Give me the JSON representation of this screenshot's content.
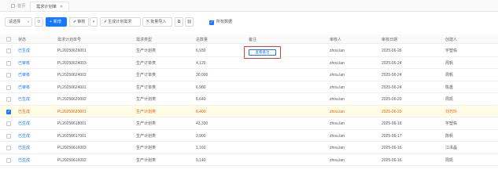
{
  "tabs": {
    "home": "首页",
    "current": "需求计划单"
  },
  "toolbar": {
    "select_value": "请选择",
    "new_label": "新增",
    "audit_label": "审核",
    "generate_label": "生成计划需求",
    "import_label": "批量导入",
    "show_all_label": "所有数据"
  },
  "table": {
    "headers": {
      "status": "状态",
      "no": "需求计划单号",
      "type": "需求类型",
      "qty": "总数量",
      "memo": "备注",
      "auditor": "审核人",
      "audit_date": "审核日期",
      "creator": "创建人"
    },
    "rows": [
      {
        "status": "已生成",
        "no": "PL20250626001",
        "type": "生产计划类",
        "qty": "6,930",
        "memo": "",
        "auditor": "zhou.lan",
        "date": "2025-06-26",
        "creator": "宇塑佑"
      },
      {
        "status": "已审核",
        "no": "PL20250624003",
        "type": "生产订单类",
        "qty": "4,120",
        "memo": "",
        "auditor": "zhou.lan",
        "date": "2025-06-24",
        "creator": "周帆"
      },
      {
        "status": "已审核",
        "no": "PL20250624002",
        "type": "生产订单类",
        "qty": "30,000",
        "memo": "",
        "auditor": "zhou.lan",
        "date": "2025-06-24",
        "creator": "周帆"
      },
      {
        "status": "已审核",
        "no": "PL20250624001",
        "type": "生产订单类",
        "qty": "6,980",
        "memo": "",
        "auditor": "zhou.lan",
        "date": "2025-06-24",
        "creator": "陈勇"
      },
      {
        "status": "已生成",
        "no": "PL20250620002",
        "type": "生产计划类",
        "qty": "5,640",
        "memo": "",
        "auditor": "zhou.lan",
        "date": "2025-06-20",
        "creator": "周凯"
      },
      {
        "status": "已生成",
        "no": "PL20250620001",
        "type": "生产计划类",
        "qty": "6,400",
        "memo": "",
        "auditor": "zhou.lan",
        "date": "2025-06-20",
        "creator": "刘巧玲"
      },
      {
        "status": "已生成",
        "no": "PL20250618001",
        "type": "生产计划类",
        "qty": "43,330",
        "memo": "",
        "auditor": "zhou.lan",
        "date": "2025-06-18",
        "creator": "宇塑佑"
      },
      {
        "status": "已生成",
        "no": "PL20250617001",
        "type": "生产计划类",
        "qty": "3,900",
        "memo": "",
        "auditor": "zhou.lan",
        "date": "2025-06-17",
        "creator": "陈帆"
      },
      {
        "status": "已生成",
        "no": "PL20250616003",
        "type": "生产计划类",
        "qty": "1,160",
        "memo": "",
        "auditor": "zhou.lan",
        "date": "2025-06-16",
        "creator": "江泽晶"
      },
      {
        "status": "已生成",
        "no": "PL20250616002",
        "type": "生产计划类",
        "qty": "9,140",
        "memo": "",
        "auditor": "zhou.lan",
        "date": "2025-06-16",
        "creator": "周凯"
      }
    ]
  },
  "memo_button": {
    "label": "查看备注"
  },
  "colors": {
    "primary": "#1677ff",
    "selected_row_bg": "#fffde6",
    "selected_text": "#e8590c",
    "highlight_border": "#e53935"
  },
  "selected_row_index": 5
}
